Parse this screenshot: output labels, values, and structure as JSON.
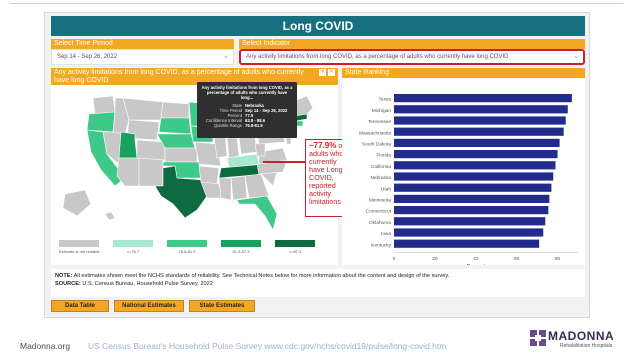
{
  "dashboard": {
    "title": "Long COVID",
    "time_period": {
      "header": "Select Time Period",
      "value": "Sep 14 - Sep 26, 2022"
    },
    "indicator": {
      "header": "Select Indicator",
      "value": "Any activity limitations from long COVID, as a percentage of adults who currently have long COVID"
    },
    "map_panel": {
      "header": "Any activity limitations from long COVID, as a percentage of adults who currently have long COVID",
      "legend": [
        {
          "label": "Estimate is not reliable.",
          "color": "#c8c8c8"
        },
        {
          "label": "<=76.7",
          "color": "#a7e8cf"
        },
        {
          "label": "76.8-81.9",
          "color": "#3ec98a"
        },
        {
          "label": "81.9-87.3",
          "color": "#18a260"
        },
        {
          "label": ">=87.3",
          "color": "#0e6b41"
        }
      ],
      "tooltip": {
        "title": "Any activity limitations from long COVID, as a percentage of adults who currently have long...",
        "rows": [
          {
            "k": "State",
            "v": "Nebraska"
          },
          {
            "k": "Time Period",
            "v": "Sep 14 - Sep 26, 2022"
          },
          {
            "k": "Percent",
            "v": "77.9"
          },
          {
            "k": "Confidence Interval",
            "v": "63.8 - 88.6"
          },
          {
            "k": "Quartile Range",
            "v": "76.8-81.9"
          }
        ]
      },
      "callout": {
        "value": "~77.9%",
        "text": "of adults who currently have Long COVID, reported activity limitations"
      }
    },
    "ranking": {
      "header": "State Ranking",
      "x_label": "Percent",
      "ticks": [
        "0",
        "20",
        "40",
        "60",
        "80"
      ],
      "bar_color": "#232c8c"
    },
    "note": {
      "note_label": "NOTE:",
      "note_text": "All estimates shown meet the NCHS standards of reliability. See Technical Notes below for more information about the content and design of the survey.",
      "source_label": "SOURCE:",
      "source_text": "U.S. Census Bureau, Household Pulse Survey, 2022"
    },
    "buttons": [
      "Data Table",
      "National Estimates",
      "State Estimates"
    ]
  },
  "footer": {
    "org": "Madonna.org",
    "source": "US Census Bureau's Household Pulse Survey www.cdc.gov/nchs/covid19/pulse/long-covid.htm",
    "logo_name": "MADONNA",
    "logo_sub": "Rehabilitation Hospitals"
  },
  "chart_data": {
    "type": "bar",
    "orientation": "horizontal",
    "title": "State Ranking",
    "xlabel": "Percent",
    "xlim": [
      0,
      90
    ],
    "categories": [
      "Texas",
      "Michigan",
      "Tennessee",
      "Massachusetts",
      "South Dakota",
      "Florida",
      "California",
      "Nebraska",
      "Utah",
      "Minnesota",
      "Connecticut",
      "Oklahoma",
      "Iowa",
      "Kentucky"
    ],
    "values": [
      87,
      85,
      84,
      83,
      81,
      80,
      79,
      77.9,
      77,
      76,
      75.5,
      74,
      73,
      71
    ]
  }
}
